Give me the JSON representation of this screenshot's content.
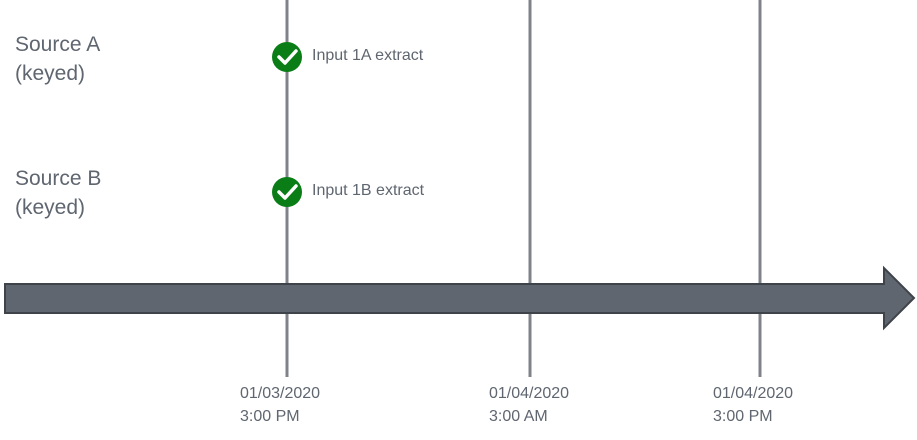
{
  "colors": {
    "axis": "#5f6670",
    "line": "#7f8389",
    "check": "#0a7d16",
    "text": "#5f6670"
  },
  "sources": [
    {
      "name": "Source A",
      "qualifier": "(keyed)",
      "event": "Input 1A extract"
    },
    {
      "name": "Source B",
      "qualifier": "(keyed)",
      "event": "Input 1B extract"
    }
  ],
  "timestamps": [
    {
      "date": "01/03/2020",
      "time": "3:00 PM"
    },
    {
      "date": "01/04/2020",
      "time": "3:00 AM"
    },
    {
      "date": "01/04/2020",
      "time": "3:00 PM"
    }
  ]
}
